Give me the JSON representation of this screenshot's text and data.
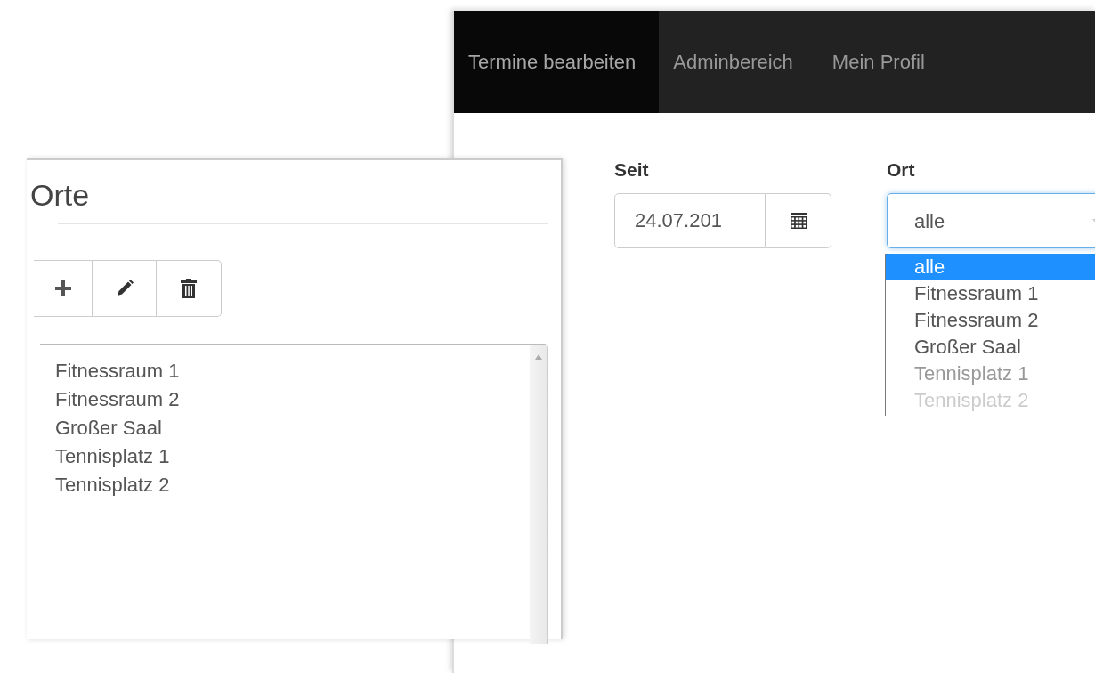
{
  "navbar": {
    "tabs": [
      {
        "label": "Termine bearbeiten",
        "selected": true
      },
      {
        "label": "Adminbereich",
        "selected": false
      },
      {
        "label": "Mein Profil",
        "selected": false
      }
    ]
  },
  "filters": {
    "since": {
      "label": "Seit",
      "value": "24.07.201"
    },
    "location": {
      "label": "Ort",
      "value": "alle",
      "expanded": true,
      "options": [
        {
          "label": "alle",
          "selected": true
        },
        {
          "label": "Fitnessraum 1",
          "selected": false
        },
        {
          "label": "Fitnessraum 2",
          "selected": false
        },
        {
          "label": "Großer Saal",
          "selected": false
        },
        {
          "label": "Tennisplatz 1",
          "selected": false
        },
        {
          "label": "Tennisplatz 2",
          "selected": false
        }
      ]
    }
  },
  "locations_panel": {
    "title": "Orte",
    "toolbar": [
      {
        "kind": "add"
      },
      {
        "kind": "edit"
      },
      {
        "kind": "delete"
      }
    ],
    "items": [
      {
        "label": "Fitnessraum 1",
        "selected": false
      },
      {
        "label": "Fitnessraum 2",
        "selected": false
      },
      {
        "label": "Großer Saal",
        "selected": false
      },
      {
        "label": "Tennisplatz 1",
        "selected": false
      },
      {
        "label": "Tennisplatz 2",
        "selected": false
      }
    ]
  }
}
